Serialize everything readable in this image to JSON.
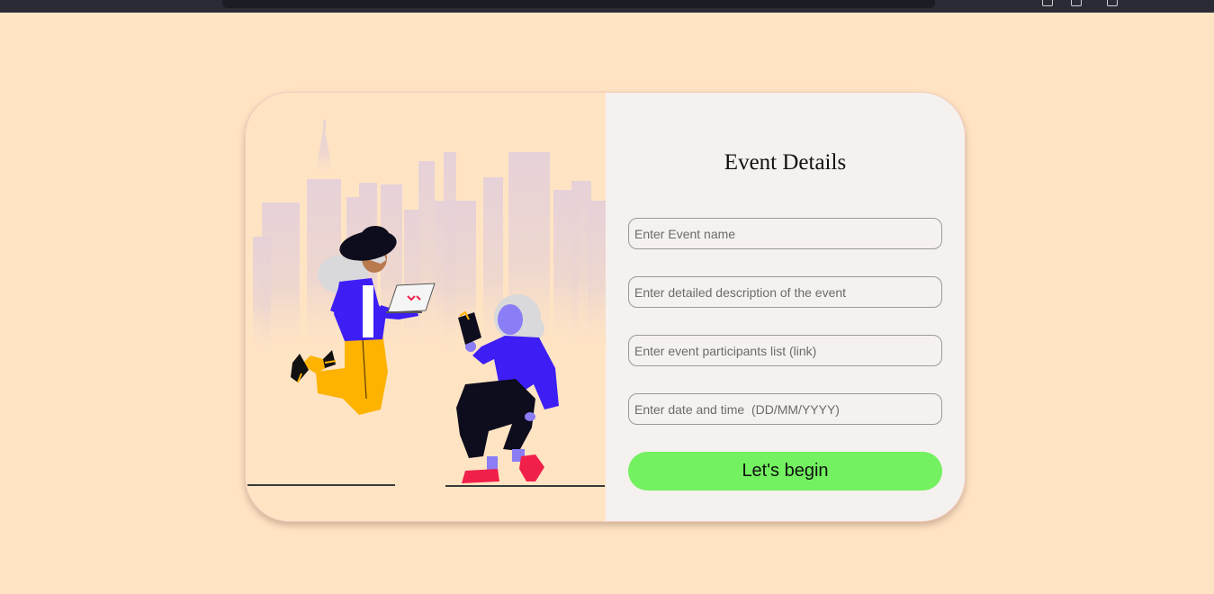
{
  "form": {
    "title": "Event Details",
    "fields": [
      {
        "value": "",
        "placeholder": "Enter Event name"
      },
      {
        "value": "",
        "placeholder": "Enter detailed description of the event"
      },
      {
        "value": "",
        "placeholder": "Enter event participants list (link)"
      },
      {
        "value": "",
        "placeholder": "Enter date and time  (DD/MM/YYYY)"
      }
    ],
    "submit_label": "Let's begin"
  },
  "colors": {
    "page_background": "#ffe4c4",
    "form_panel": "#f5f1ee",
    "submit_button": "#73f160",
    "character_jacket": "#3d1ef5",
    "character_pants_yellow": "#fdb300",
    "character_shoes_red": "#f0204a"
  },
  "illustration": {
    "icons": [
      "city-skyline",
      "woman-with-laptop",
      "woman-with-book"
    ]
  }
}
